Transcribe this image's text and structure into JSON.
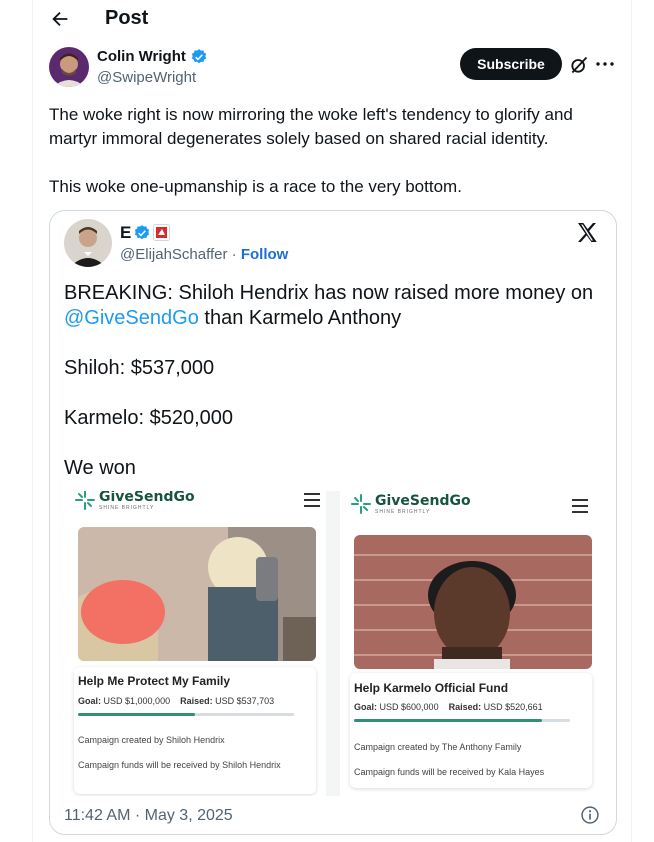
{
  "header": {
    "title": "Post",
    "back_icon": "back-arrow-icon"
  },
  "author": {
    "name": "Colin Wright",
    "handle": "@SwipeWright",
    "verified": true
  },
  "actions": {
    "subscribe_label": "Subscribe",
    "grok_icon": "grok-icon",
    "more_icon": "more-icon"
  },
  "post": {
    "paragraphs": [
      "The woke right is now mirroring the woke left's tendency to glorify and martyr immoral degenerates solely based on shared racial identity.",
      "This woke one-upmanship is a race to the very bottom."
    ]
  },
  "quote": {
    "name": "E",
    "handle": "@ElijahSchaffer",
    "separator": " · ",
    "follow_label": "Follow",
    "logo_icon": "x-logo-icon",
    "text_lead": "BREAKING: Shiloh Hendrix has now raised more money on ",
    "mention": "@GiveSendGo",
    "text_tail": " than Karmelo Anthony",
    "line_shiloh": "Shiloh: $537,000",
    "line_karmelo": "Karmelo: $520,000",
    "line_won": "We won",
    "timestamp": "11:42 AM · May 3, 2025",
    "info_icon": "info-icon"
  },
  "screenshots": [
    {
      "brand": "GiveSendGo",
      "tagline": "SHINE BRIGHTLY",
      "campaign_title": "Help Me Protect My Family",
      "goal_label": "Goal:",
      "goal_value": "USD $1,000,000",
      "raised_label": "Raised:",
      "raised_value": "USD $537,703",
      "progress": 0.54,
      "created_line": "Campaign created by Shiloh Hendrix",
      "funds_line": "Campaign funds will be received by Shiloh Hendrix"
    },
    {
      "brand": "GiveSendGo",
      "tagline": "SHINE BRIGHTLY",
      "campaign_title": "Help Karmelo Official Fund",
      "goal_label": "Goal:",
      "goal_value": "USD $600,000",
      "raised_label": "Raised:",
      "raised_value": "USD $520,661",
      "progress": 0.87,
      "created_line": "Campaign created by The Anthony Family",
      "funds_line": "Campaign funds will be received by Kala Hayes"
    }
  ],
  "colors": {
    "accent": "#1d9bf0",
    "follow": "#1d6fd0",
    "subscribe_bg": "#0f1419",
    "progress": "#2f8f79",
    "brand_green": "#17543f"
  }
}
